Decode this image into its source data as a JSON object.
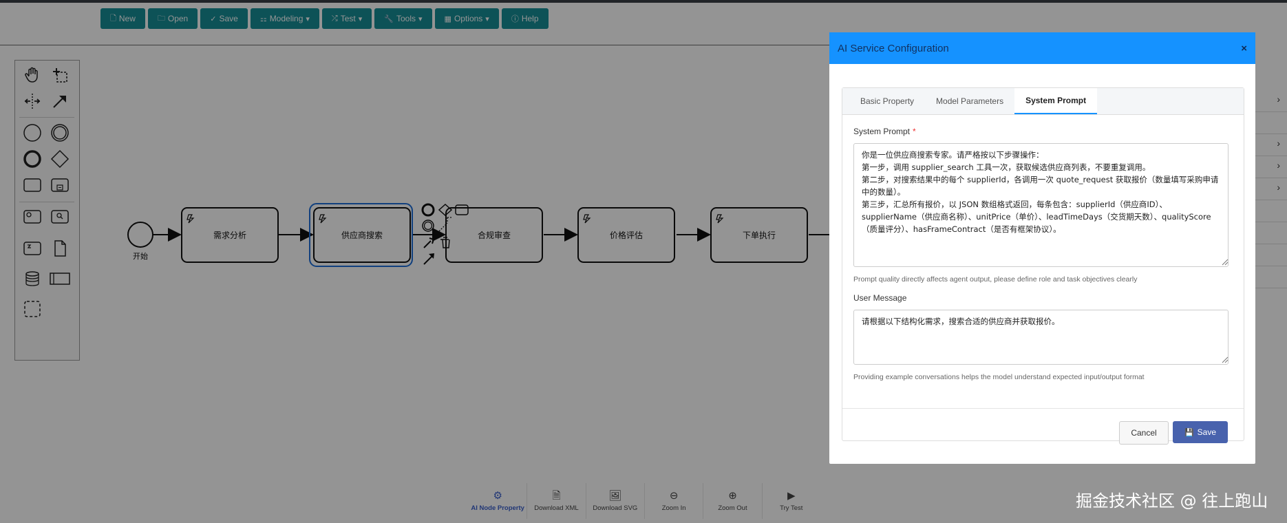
{
  "toolbar": {
    "new": "New",
    "open": "Open",
    "save": "Save",
    "modeling": "Modeling",
    "test": "Test",
    "tools": "Tools",
    "options": "Options",
    "help": "Help"
  },
  "diagram": {
    "start_label": "开始",
    "tasks": [
      "需求分析",
      "供应商搜索",
      "合规审查",
      "价格评估",
      "下单执行"
    ]
  },
  "modal": {
    "title": "AI Service Configuration",
    "close": "×",
    "tabs": [
      "Basic Property",
      "Model Parameters",
      "System Prompt"
    ],
    "active_tab": "System Prompt",
    "system_prompt_label": "System Prompt",
    "required_mark": "*",
    "system_prompt_value": "你是一位供应商搜索专家。请严格按以下步骤操作：\n第一步，调用 supplier_search 工具一次，获取候选供应商列表，不要重复调用。\n第二步，对搜索结果中的每个 supplierId，各调用一次 quote_request 获取报价（数量填写采购申请中的数量）。\n第三步，汇总所有报价，以 JSON 数组格式返回，每条包含：supplierId（供应商ID）、supplierName（供应商名称）、unitPrice（单价）、leadTimeDays（交货期天数）、qualityScore（质量评分）、hasFrameContract（是否有框架协议）。",
    "system_prompt_hint": "Prompt quality directly affects agent output, please define role and task objectives clearly",
    "user_message_label": "User Message",
    "user_message_value": "请根据以下结构化需求，搜索合适的供应商并获取报价。",
    "user_message_hint": "Providing example conversations helps the model understand expected input/output format",
    "cancel": "Cancel",
    "save": "Save"
  },
  "bottom_bar": [
    {
      "label": "AI Node Property",
      "icon": "gear-icon"
    },
    {
      "label": "Download XML",
      "icon": "file-icon"
    },
    {
      "label": "Download SVG",
      "icon": "image-icon"
    },
    {
      "label": "Zoom In",
      "icon": "zoom-in-icon"
    },
    {
      "label": "Zoom Out",
      "icon": "zoom-out-icon"
    },
    {
      "label": "Try Test",
      "icon": "play-icon"
    }
  ],
  "watermark": "掘金技术社区 @ 往上跑山",
  "colors": {
    "toolbar_button": "#178d96",
    "modal_header": "#1592ff",
    "save_button": "#4862ad",
    "selected_task": "#1e6fd9"
  }
}
